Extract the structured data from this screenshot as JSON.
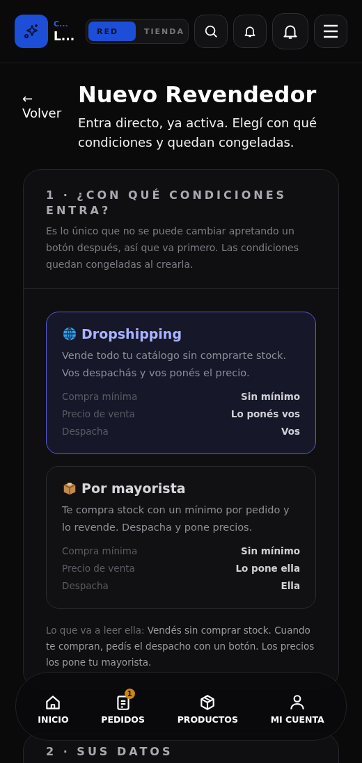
{
  "header": {
    "brand_small": "C...",
    "brand_name": "L...",
    "tabs": [
      {
        "label": "RED",
        "selected": true
      },
      {
        "label": "TIENDA",
        "selected": false
      }
    ]
  },
  "back": {
    "arrow": "←",
    "label": "Volver"
  },
  "page": {
    "title": "Nuevo Revendedor",
    "subtitle": "Entra directo, ya activa. Elegí con qué condiciones y quedan congeladas."
  },
  "section_1": {
    "title": "1 · ¿CON QUÉ CONDICIONES ENTRA?",
    "description": "Es lo único que no se puede cambiar apretando un botón después, así que va primero. Las condiciones quedan congeladas al crearla.",
    "options": [
      {
        "kind": "globe",
        "title": "Dropshipping",
        "selected": true,
        "description": "Vende todo tu catálogo sin comprarte stock. Vos despachás y vos ponés el precio.",
        "terms": [
          {
            "label": "Compra mínima",
            "value": "Sin mínimo"
          },
          {
            "label": "Precio de venta",
            "value": "Lo ponés vos"
          },
          {
            "label": "Despacha",
            "value": "Vos"
          }
        ]
      },
      {
        "kind": "box",
        "title": "Por mayorista",
        "selected": false,
        "description": "Te compra stock con un mínimo por pedido y lo revende. Despacha y pone precios.",
        "terms": [
          {
            "label": "Compra mínima",
            "value": "Sin mínimo"
          },
          {
            "label": "Precio de venta",
            "value": "Lo pone ella"
          },
          {
            "label": "Despacha",
            "value": "Ella"
          }
        ]
      }
    ],
    "preview": {
      "lead": "Lo que va a leer ella:",
      "text": "Vendés sin comprar stock. Cuando te compran, pedís el despacho con un botón. Los precios los pone tu mayorista."
    }
  },
  "section_2": {
    "title": "2 · SUS DATOS"
  },
  "bottom_nav": [
    {
      "kind": "home",
      "label": "INICIO"
    },
    {
      "kind": "orders",
      "label": "PEDIDOS",
      "badge": "1"
    },
    {
      "kind": "products",
      "label": "PRODUCTOS"
    },
    {
      "kind": "account",
      "label": "MI CUENTA"
    }
  ]
}
